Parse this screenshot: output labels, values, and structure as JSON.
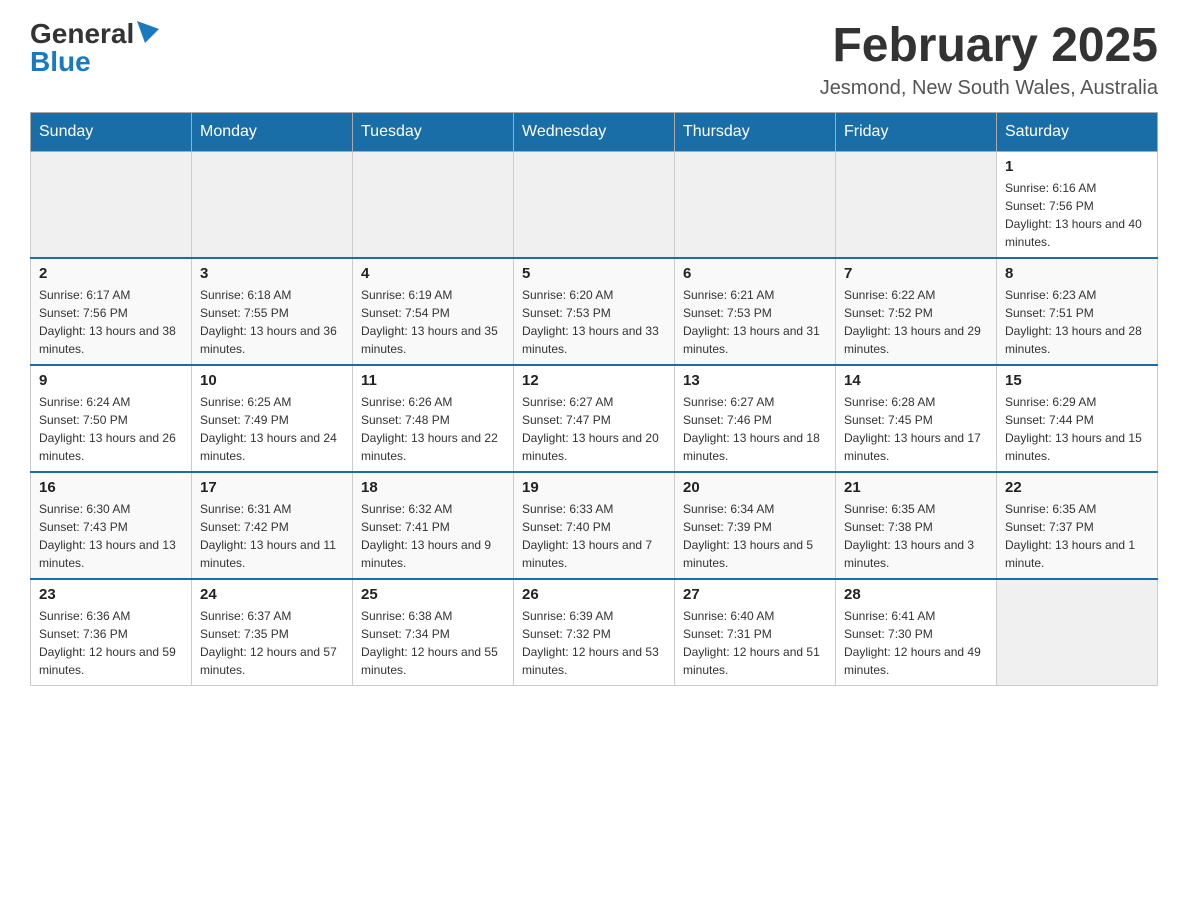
{
  "header": {
    "logo_general": "General",
    "logo_blue": "Blue",
    "month_title": "February 2025",
    "location": "Jesmond, New South Wales, Australia"
  },
  "days_of_week": [
    "Sunday",
    "Monday",
    "Tuesday",
    "Wednesday",
    "Thursday",
    "Friday",
    "Saturday"
  ],
  "weeks": [
    {
      "days": [
        {
          "number": "",
          "info": ""
        },
        {
          "number": "",
          "info": ""
        },
        {
          "number": "",
          "info": ""
        },
        {
          "number": "",
          "info": ""
        },
        {
          "number": "",
          "info": ""
        },
        {
          "number": "",
          "info": ""
        },
        {
          "number": "1",
          "info": "Sunrise: 6:16 AM\nSunset: 7:56 PM\nDaylight: 13 hours and 40 minutes."
        }
      ]
    },
    {
      "days": [
        {
          "number": "2",
          "info": "Sunrise: 6:17 AM\nSunset: 7:56 PM\nDaylight: 13 hours and 38 minutes."
        },
        {
          "number": "3",
          "info": "Sunrise: 6:18 AM\nSunset: 7:55 PM\nDaylight: 13 hours and 36 minutes."
        },
        {
          "number": "4",
          "info": "Sunrise: 6:19 AM\nSunset: 7:54 PM\nDaylight: 13 hours and 35 minutes."
        },
        {
          "number": "5",
          "info": "Sunrise: 6:20 AM\nSunset: 7:53 PM\nDaylight: 13 hours and 33 minutes."
        },
        {
          "number": "6",
          "info": "Sunrise: 6:21 AM\nSunset: 7:53 PM\nDaylight: 13 hours and 31 minutes."
        },
        {
          "number": "7",
          "info": "Sunrise: 6:22 AM\nSunset: 7:52 PM\nDaylight: 13 hours and 29 minutes."
        },
        {
          "number": "8",
          "info": "Sunrise: 6:23 AM\nSunset: 7:51 PM\nDaylight: 13 hours and 28 minutes."
        }
      ]
    },
    {
      "days": [
        {
          "number": "9",
          "info": "Sunrise: 6:24 AM\nSunset: 7:50 PM\nDaylight: 13 hours and 26 minutes."
        },
        {
          "number": "10",
          "info": "Sunrise: 6:25 AM\nSunset: 7:49 PM\nDaylight: 13 hours and 24 minutes."
        },
        {
          "number": "11",
          "info": "Sunrise: 6:26 AM\nSunset: 7:48 PM\nDaylight: 13 hours and 22 minutes."
        },
        {
          "number": "12",
          "info": "Sunrise: 6:27 AM\nSunset: 7:47 PM\nDaylight: 13 hours and 20 minutes."
        },
        {
          "number": "13",
          "info": "Sunrise: 6:27 AM\nSunset: 7:46 PM\nDaylight: 13 hours and 18 minutes."
        },
        {
          "number": "14",
          "info": "Sunrise: 6:28 AM\nSunset: 7:45 PM\nDaylight: 13 hours and 17 minutes."
        },
        {
          "number": "15",
          "info": "Sunrise: 6:29 AM\nSunset: 7:44 PM\nDaylight: 13 hours and 15 minutes."
        }
      ]
    },
    {
      "days": [
        {
          "number": "16",
          "info": "Sunrise: 6:30 AM\nSunset: 7:43 PM\nDaylight: 13 hours and 13 minutes."
        },
        {
          "number": "17",
          "info": "Sunrise: 6:31 AM\nSunset: 7:42 PM\nDaylight: 13 hours and 11 minutes."
        },
        {
          "number": "18",
          "info": "Sunrise: 6:32 AM\nSunset: 7:41 PM\nDaylight: 13 hours and 9 minutes."
        },
        {
          "number": "19",
          "info": "Sunrise: 6:33 AM\nSunset: 7:40 PM\nDaylight: 13 hours and 7 minutes."
        },
        {
          "number": "20",
          "info": "Sunrise: 6:34 AM\nSunset: 7:39 PM\nDaylight: 13 hours and 5 minutes."
        },
        {
          "number": "21",
          "info": "Sunrise: 6:35 AM\nSunset: 7:38 PM\nDaylight: 13 hours and 3 minutes."
        },
        {
          "number": "22",
          "info": "Sunrise: 6:35 AM\nSunset: 7:37 PM\nDaylight: 13 hours and 1 minute."
        }
      ]
    },
    {
      "days": [
        {
          "number": "23",
          "info": "Sunrise: 6:36 AM\nSunset: 7:36 PM\nDaylight: 12 hours and 59 minutes."
        },
        {
          "number": "24",
          "info": "Sunrise: 6:37 AM\nSunset: 7:35 PM\nDaylight: 12 hours and 57 minutes."
        },
        {
          "number": "25",
          "info": "Sunrise: 6:38 AM\nSunset: 7:34 PM\nDaylight: 12 hours and 55 minutes."
        },
        {
          "number": "26",
          "info": "Sunrise: 6:39 AM\nSunset: 7:32 PM\nDaylight: 12 hours and 53 minutes."
        },
        {
          "number": "27",
          "info": "Sunrise: 6:40 AM\nSunset: 7:31 PM\nDaylight: 12 hours and 51 minutes."
        },
        {
          "number": "28",
          "info": "Sunrise: 6:41 AM\nSunset: 7:30 PM\nDaylight: 12 hours and 49 minutes."
        },
        {
          "number": "",
          "info": ""
        }
      ]
    }
  ]
}
